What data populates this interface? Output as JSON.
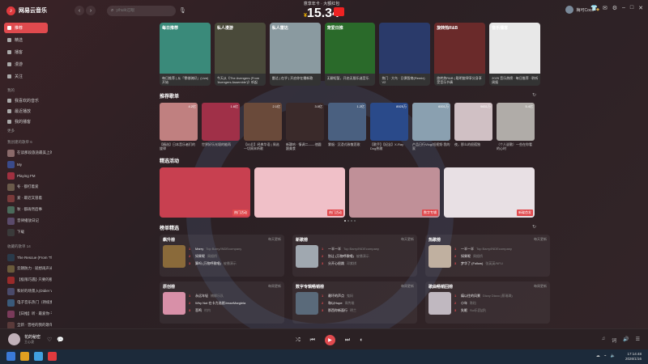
{
  "app": {
    "name": "网易云音乐"
  },
  "search": {
    "placeholder": "yihuik过眼"
  },
  "promo": {
    "top_text": "意享年卡 · 大额红包",
    "currency": "¥",
    "price": "15.34"
  },
  "user": {
    "name": "梅可Coco"
  },
  "sidebar": {
    "items": [
      {
        "label": "推荐",
        "active": true
      },
      {
        "label": "精选",
        "active": false
      },
      {
        "label": "播客",
        "active": false
      },
      {
        "label": "漫游",
        "active": false
      },
      {
        "label": "关注",
        "active": false
      }
    ],
    "my_head": "我的",
    "my_items": [
      {
        "label": "我喜欢的音乐"
      },
      {
        "label": "最近播放"
      },
      {
        "label": "我的播客"
      }
    ],
    "more": "更多",
    "created_head": "我创建的歌单 6",
    "created": [
      {
        "label": "在读那段旅途最美上的",
        "color": "#8a6a6a"
      },
      {
        "label": "My",
        "color": "#3a4a8a"
      },
      {
        "label": "Playing FM",
        "color": "#a03040"
      },
      {
        "label": "冬 · 都打着爱",
        "color": "#6a5a4a"
      },
      {
        "label": "爱 · 最近又冒着",
        "color": "#7a3a3a"
      },
      {
        "label": "秋 · 都再然后事",
        "color": "#4a6a5a"
      },
      {
        "label": "音律播放日记",
        "color": "#5a4a6a"
      },
      {
        "label": "下载",
        "color": "#3a3a3a"
      }
    ],
    "collected_head": "收藏的歌单 14",
    "collected": [
      {
        "label": "The Rescue (From 'The...",
        "color": "#2a3a4a"
      },
      {
        "label": "云朗防力 · 就想再声光图",
        "color": "#6a5a3a"
      },
      {
        "label": "【极限巧遇】·只要的那年",
        "color": "#9a2a2a"
      },
      {
        "label": "和好的场景入(Didier Wilde)",
        "color": "#4a4a6a"
      },
      {
        "label": "电子音乐热门（持续更新）人生里",
        "color": "#3a5a7a"
      },
      {
        "label": "【日推】听 · 最爱你·不再听歌",
        "color": "#7a3a5a"
      },
      {
        "label": "全新 · 曾经的我的歌单",
        "color": "#5a3a3a"
      }
    ]
  },
  "sections": {
    "recommend_title": "推荐歌单",
    "featured_title": "精选活动",
    "charts_title": "榜单精选"
  },
  "top_cards": [
    {
      "title": "每日推荐",
      "desc": "每日推荐 | 从「零借骑好」(Live) 开始",
      "color": "#3a8a7a"
    },
    {
      "title": "私人漫游",
      "desc": "今天从《The Avengers (From 'Avengers Assemble')》听起",
      "color": "#4a4a3a"
    },
    {
      "title": "私人雷达",
      "desc": "雷达 | 在乎 | 开启你在播新歌",
      "color": "#8a9aa0"
    },
    {
      "title": "宠爱日推",
      "desc": "无聊短暂，开启无限乐迷音乐",
      "color": "#2a6a2a"
    },
    {
      "title": "",
      "desc": "热门 · 大鸟 · 日俱智商(Remix)  V2",
      "color": "#2a3a6a"
    },
    {
      "title": "旋转热R&B",
      "desc": "旋转热R&B | 聪明旋律享分身享受音乐节奏",
      "color": "#6a2a2a"
    },
    {
      "title": "音乐播客",
      "desc": "2025 音乐热榜 · 每日推荐 · 聆听周报",
      "color": "#e8e8e8"
    }
  ],
  "playlists": [
    {
      "name": "【精选】日本音乐者们的旋律",
      "plays": "4.2亿",
      "color": "#c08080"
    },
    {
      "name": "世界好乐光境的能再",
      "plays": "1.6亿",
      "color": "#a03048"
    },
    {
      "name": "【00后】经典华语 | 周选一切周末听歌",
      "plays": "2.1亿",
      "color": "#6a4a3a"
    },
    {
      "name": "新疆哈 · 情调二——他圆跟美食",
      "plays": "3.0亿",
      "color": "#3a2a2a"
    },
    {
      "name": "雾烟 · 沉浸式致敬悲歌",
      "plays": "1.2亿",
      "color": "#4a6080"
    },
    {
      "name": "【歌手】【纪念】X-Ray Dog热歌",
      "plays": "8925万",
      "color": "#2a4a8a"
    },
    {
      "name": "产品日行Vlog/短视频·我的家",
      "plays": "6001万",
      "color": "#8aa0b0"
    },
    {
      "name": "夜，那么的很孤独",
      "plays": "9831万",
      "color": "#d0c0c4"
    },
    {
      "name": "（个人说歌）一些在你看的心时",
      "plays": "5.4亿",
      "color": "#b0aca8"
    }
  ],
  "banners": [
    {
      "tag": "热门活动",
      "color": "#c84050"
    },
    {
      "tag": "热门活动",
      "color": "#f0c0c8"
    },
    {
      "tag": "数字专辑",
      "color": "#c09098"
    },
    {
      "tag": "新碟首发",
      "color": "#e8e0e4"
    }
  ],
  "charts": [
    {
      "name": "飙升榜",
      "sub": "每天更新",
      "color": "#8a6a3a",
      "rows": [
        {
          "n": "1",
          "t": "Marry",
          "a": "Top Barry/INDEcompany"
        },
        {
          "n": "2",
          "t": "如果呢",
          "a": "周韶桥"
        },
        {
          "n": "3",
          "t": "算吗 (万物呼歌唱)",
          "a": "被播演示"
        }
      ]
    },
    {
      "name": "新歌榜",
      "sub": "每天更新",
      "color": "#a0a8b0",
      "rows": [
        {
          "n": "1",
          "t": "一半一半",
          "a": "Top Barry/INDEcompany"
        },
        {
          "n": "2",
          "t": "别让 (万物呼歌唱)",
          "a": "被播演示"
        },
        {
          "n": "3",
          "t": "分开心很跳",
          "a": "邓紫棋"
        }
      ]
    },
    {
      "name": "热歌榜",
      "sub": "每天更新",
      "color": "#c0b0a0",
      "rows": [
        {
          "n": "1",
          "t": "一半一半",
          "a": "Top Barry/INDEcompany"
        },
        {
          "n": "2",
          "t": "如果呢",
          "a": "周韶桥"
        },
        {
          "n": "3",
          "t": "梦华了 (Follow)",
          "a": "张英英/NFLI"
        }
      ]
    },
    {
      "name": "原创榜",
      "sub": "每周更新",
      "color": "#d890a8",
      "rows": [
        {
          "n": "1",
          "t": "永远年轻",
          "a": "楠柳乐队"
        },
        {
          "n": "2",
          "t": "Why Not 在卡力选就JesseMargiela",
          "a": ""
        },
        {
          "n": "3",
          "t": "悲鸣",
          "a": "村内"
        }
      ]
    },
    {
      "name": "数字专辑畅销榜",
      "sub": "每周更新",
      "color": "#5a6a7a",
      "rows": [
        {
          "n": "1",
          "t": "最坏的声点",
          "a": "鬼妈"
        },
        {
          "n": "2",
          "t": "和以Hope",
          "a": "周传雄"
        },
        {
          "n": "3",
          "t": "那西你新面行",
          "a": "明兰"
        }
      ]
    },
    {
      "name": "歌曲畅销回榜",
      "sub": "每周更新",
      "color": "#c0b8c0",
      "rows": [
        {
          "n": "1",
          "t": "痛以往的风景",
          "a": "Dizzy Dizzo (蔡瑞珠)"
        },
        {
          "n": "2",
          "t": "小年",
          "a": "陈粒"
        },
        {
          "n": "3",
          "t": "失眠",
          "a": "Sui乐团(舒)"
        }
      ]
    }
  ],
  "player": {
    "title": "花的秘密",
    "artist": "王心凌"
  },
  "taskbar": {
    "time": "17:14:48",
    "date": "2026/1/16"
  }
}
